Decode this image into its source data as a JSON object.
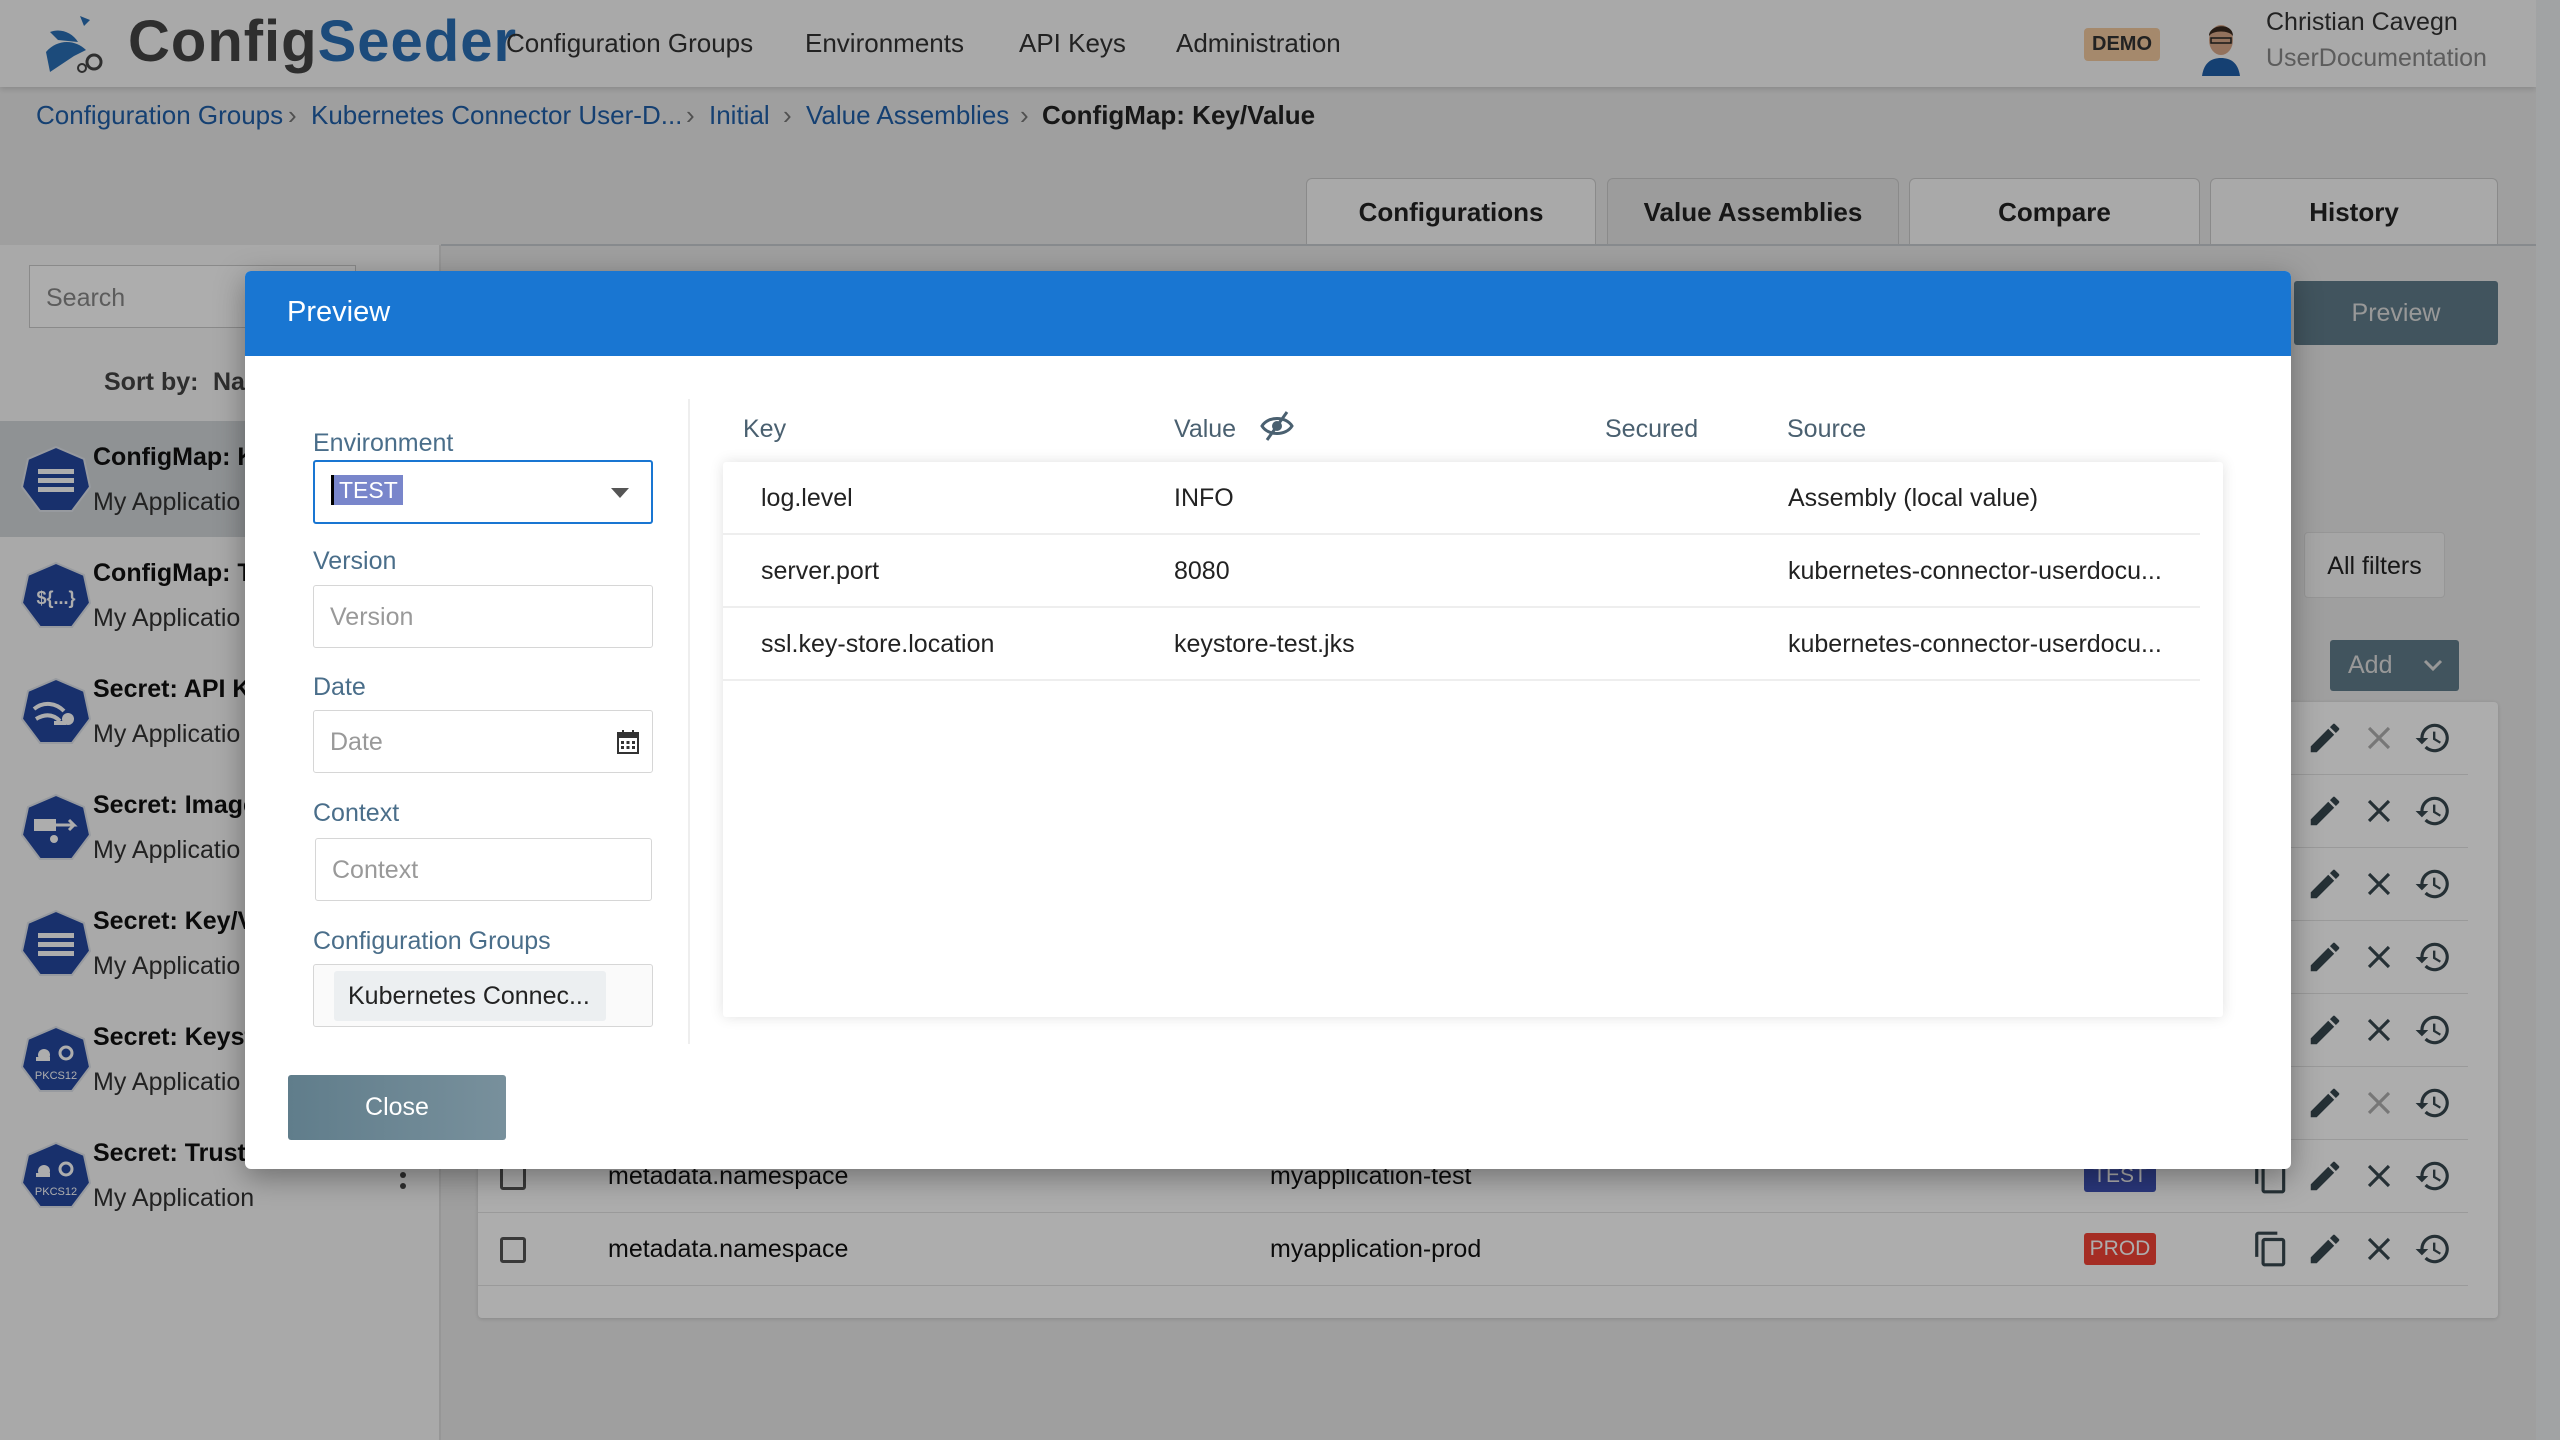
{
  "header": {
    "brand_part1": "Config",
    "brand_part2": "Seeder",
    "nav": [
      "Configuration Groups",
      "Environments",
      "API Keys",
      "Administration"
    ],
    "badge": "DEMO",
    "user_name": "Christian Cavegn",
    "user_org": "UserDocumentation"
  },
  "breadcrumb": [
    "Configuration Groups",
    "Kubernetes Connector User-D...",
    "Initial",
    "Value Assemblies",
    "ConfigMap: Key/Value"
  ],
  "tabs": [
    "Configurations",
    "Value Assemblies",
    "Compare",
    "History"
  ],
  "sidebar": {
    "search_placeholder": "Search",
    "sort_label": "Sort by:",
    "sort_value": "Na",
    "items": [
      {
        "title": "ConfigMap: K",
        "subtitle": "My Applicatio",
        "icon": "key-value-list-icon"
      },
      {
        "title": "ConfigMap: T",
        "subtitle": "My Applicatio",
        "icon": "template-icon"
      },
      {
        "title": "Secret: API K",
        "subtitle": "My Applicatio",
        "icon": "api-key-icon"
      },
      {
        "title": "Secret: Image",
        "subtitle": "My Applicatio",
        "icon": "image-pull-icon"
      },
      {
        "title": "Secret: Key/V",
        "subtitle": "My Applicatio",
        "icon": "key-value-list-icon"
      },
      {
        "title": "Secret: Keyst",
        "subtitle": "My Applicatio",
        "icon": "pkcs12-icon"
      },
      {
        "title": "Secret: Trust",
        "subtitle": "My Application",
        "icon": "pkcs12-icon"
      }
    ]
  },
  "main": {
    "preview_label": "Preview",
    "all_filters_label": "All filters",
    "add_label": "Add",
    "rows": [
      {
        "key": "",
        "value": "",
        "badge": "",
        "delete_enabled": false
      },
      {
        "key": "",
        "value": "",
        "badge": "",
        "delete_enabled": true
      },
      {
        "key": "",
        "value": "",
        "badge": "",
        "delete_enabled": true
      },
      {
        "key": "",
        "value": "",
        "badge": "",
        "delete_enabled": true
      },
      {
        "key": "",
        "value": "",
        "badge": "",
        "delete_enabled": true
      },
      {
        "key": "",
        "value": "",
        "badge": "",
        "delete_enabled": false
      },
      {
        "key": "metadata.namespace",
        "value": "myapplication-test",
        "badge": "TEST",
        "badge_color": "#3f51b5",
        "delete_enabled": true
      },
      {
        "key": "metadata.namespace",
        "value": "myapplication-prod",
        "badge": "PROD",
        "badge_color": "#f44336",
        "delete_enabled": true
      }
    ]
  },
  "modal": {
    "title": "Preview",
    "form": {
      "environment_label": "Environment",
      "environment_value": "TEST",
      "version_label": "Version",
      "version_placeholder": "Version",
      "date_label": "Date",
      "date_placeholder": "Date",
      "context_label": "Context",
      "context_placeholder": "Context",
      "groups_label": "Configuration Groups",
      "groups_chip": "Kubernetes Connec..."
    },
    "table": {
      "headers": [
        "Key",
        "Value",
        "Secured",
        "Source"
      ],
      "rows": [
        {
          "key": "log.level",
          "value": "INFO",
          "secured": "",
          "source": "Assembly (local value)"
        },
        {
          "key": "server.port",
          "value": "8080",
          "secured": "",
          "source": "kubernetes-connector-userdocu..."
        },
        {
          "key": "ssl.key-store.location",
          "value": "keystore-test.jks",
          "secured": "",
          "source": "kubernetes-connector-userdocu..."
        }
      ]
    },
    "close_label": "Close"
  },
  "colors": {
    "primary": "#1976d2",
    "secondary": "#607d8b",
    "overlay": "rgba(0,0,0,0.32)"
  }
}
